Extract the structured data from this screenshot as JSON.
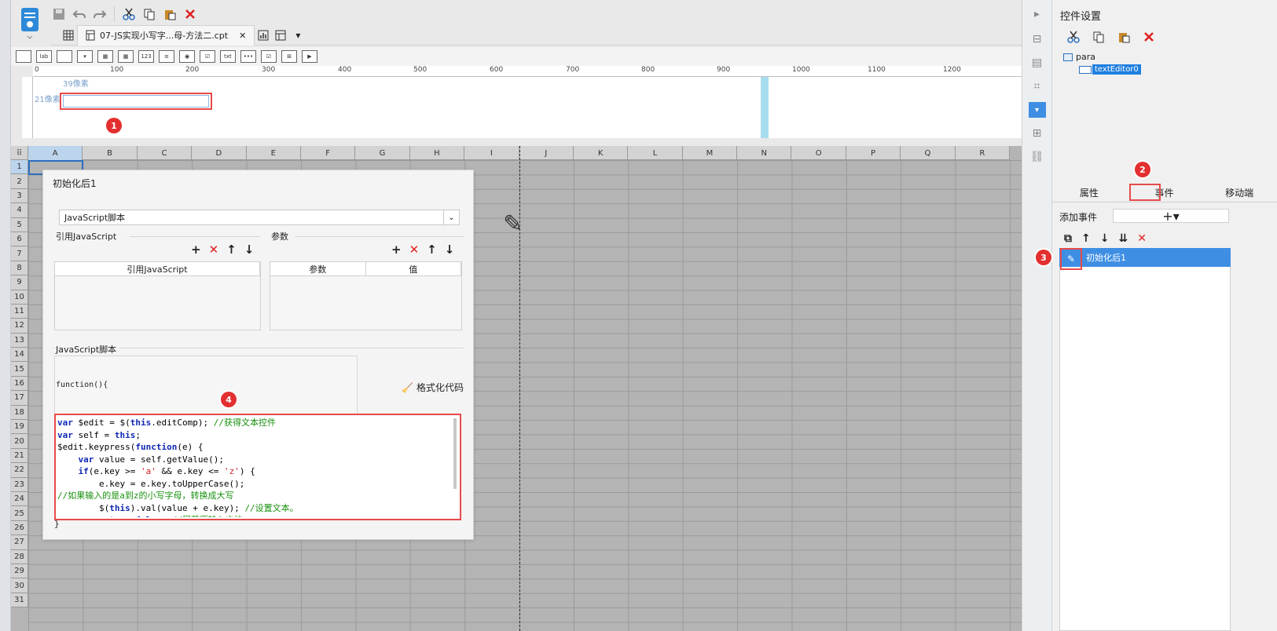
{
  "file_tab": {
    "label": "07-JS实现小写字...母-方法二.cpt"
  },
  "ruler": {
    "ticks": [
      "0",
      "100",
      "200",
      "300",
      "400",
      "500",
      "600",
      "700",
      "800",
      "900",
      "1000",
      "1100",
      "1200"
    ]
  },
  "param_pane": {
    "width_label": "39像素",
    "height_label": "21像素"
  },
  "markers": [
    "1",
    "2",
    "3",
    "4"
  ],
  "sheet": {
    "columns": [
      "A",
      "B",
      "C",
      "D",
      "E",
      "F",
      "G",
      "H",
      "I",
      "J",
      "K",
      "L",
      "M",
      "N",
      "O",
      "P",
      "Q",
      "R"
    ],
    "rows": [
      "1",
      "2",
      "3",
      "4",
      "5",
      "6",
      "7",
      "8",
      "9",
      "10",
      "11",
      "12",
      "13",
      "14",
      "15",
      "16",
      "17",
      "18",
      "19",
      "20",
      "21",
      "22",
      "23",
      "24",
      "25",
      "26",
      "27",
      "28",
      "29",
      "30",
      "31"
    ]
  },
  "dialog": {
    "title": "初始化后1",
    "type_select": "JavaScript脚本",
    "ref_js_label": "引用JavaScript",
    "params_label": "参数",
    "ref_table_header": "引用JavaScript",
    "param_table_headers": [
      "参数",
      "值"
    ],
    "script_label": "JavaScript脚本",
    "function_open": "function(){",
    "format_button": "格式化代码",
    "closing_brace": "}"
  },
  "right_panel": {
    "title": "控件设置",
    "tree_root": "para",
    "tree_child": "textEditor0",
    "tabs": [
      "属性",
      "事件",
      "移动端"
    ],
    "add_event_label": "添加事件",
    "event_item": "初始化后1"
  },
  "colors": {
    "accent_blue": "#3e8fe3",
    "highlight_red": "#e84a4a",
    "cyan_guide": "#a8dcef"
  }
}
